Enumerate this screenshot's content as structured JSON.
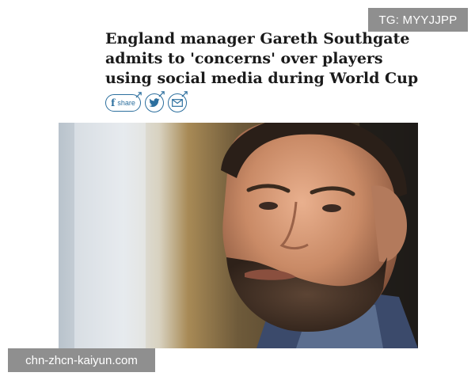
{
  "overlay_top": {
    "text": "TG: MYYJJPP"
  },
  "article": {
    "headline": "England manager Gareth Southgate admits to 'concerns' over players using social media during World Cup",
    "share": {
      "facebook_glyph": "f",
      "facebook_label": "share",
      "icons": [
        "facebook-icon",
        "twitter-icon",
        "email-icon"
      ],
      "accent": "#2c6f9e"
    },
    "photo": {
      "subject": "man-portrait-photo"
    }
  },
  "overlay_bottom": {
    "text": "chn-zhcn-kaiyun.com"
  }
}
